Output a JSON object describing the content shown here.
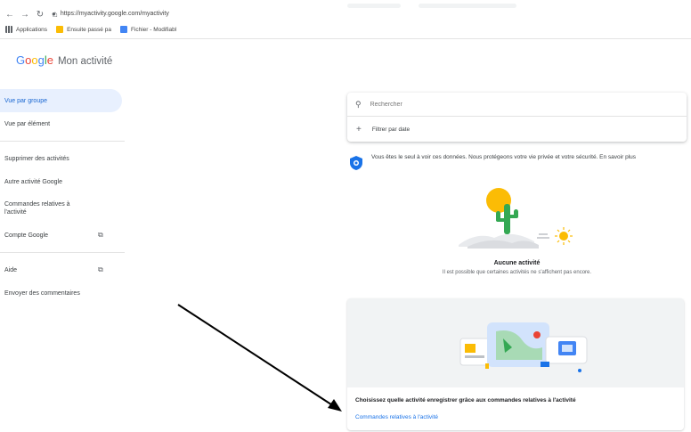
{
  "browser": {
    "url": "https://myactivity.google.com/myactivity",
    "nav_icons": [
      "back-icon",
      "forward-icon",
      "reload-icon",
      "home-icon"
    ],
    "bookmarks": [
      {
        "label": "Applications",
        "icon": "apps-icon",
        "color": "#5f6368"
      },
      {
        "label": "Ensuite passé pa",
        "icon": "folder-icon",
        "color": "#fbbc05"
      },
      {
        "label": "Fichier - Modifiabl",
        "icon": "document-icon",
        "color": "#4285f4"
      }
    ]
  },
  "header": {
    "logo_letters": [
      "G",
      "o",
      "o",
      "g",
      "l",
      "e"
    ],
    "product": "Mon activité"
  },
  "sidebar": {
    "items": [
      {
        "label": "Vue par groupe",
        "active": true
      },
      {
        "label": "Vue par élément",
        "active": false
      }
    ],
    "items2": [
      {
        "label": "Supprimer des activités"
      },
      {
        "label": "Autre activité Google"
      },
      {
        "label": "Commandes relatives à l'activité"
      },
      {
        "label": "Compte Google",
        "external": true
      }
    ],
    "items3": [
      {
        "label": "Aide",
        "external": true
      },
      {
        "label": "Envoyer des commentaires"
      }
    ]
  },
  "search": {
    "placeholder": "Rechercher",
    "filter_label": "Filtrer par date"
  },
  "privacy": {
    "text": "Vous êtes le seul à voir ces données. Nous protégeons votre vie privée et votre sécurité. En savoir plus"
  },
  "empty_state": {
    "title": "Aucune activité",
    "subtitle": "Il est possible que certaines activités ne s'affichent pas encore."
  },
  "promo": {
    "text": "Choisissez quelle activité enregistrer grâce aux commandes relatives à l'activité",
    "link": "Commandes relatives à l'activité"
  },
  "colors": {
    "accent": "#1a73e8",
    "active_bg": "#e8f0fe",
    "arrow": "#000000"
  }
}
